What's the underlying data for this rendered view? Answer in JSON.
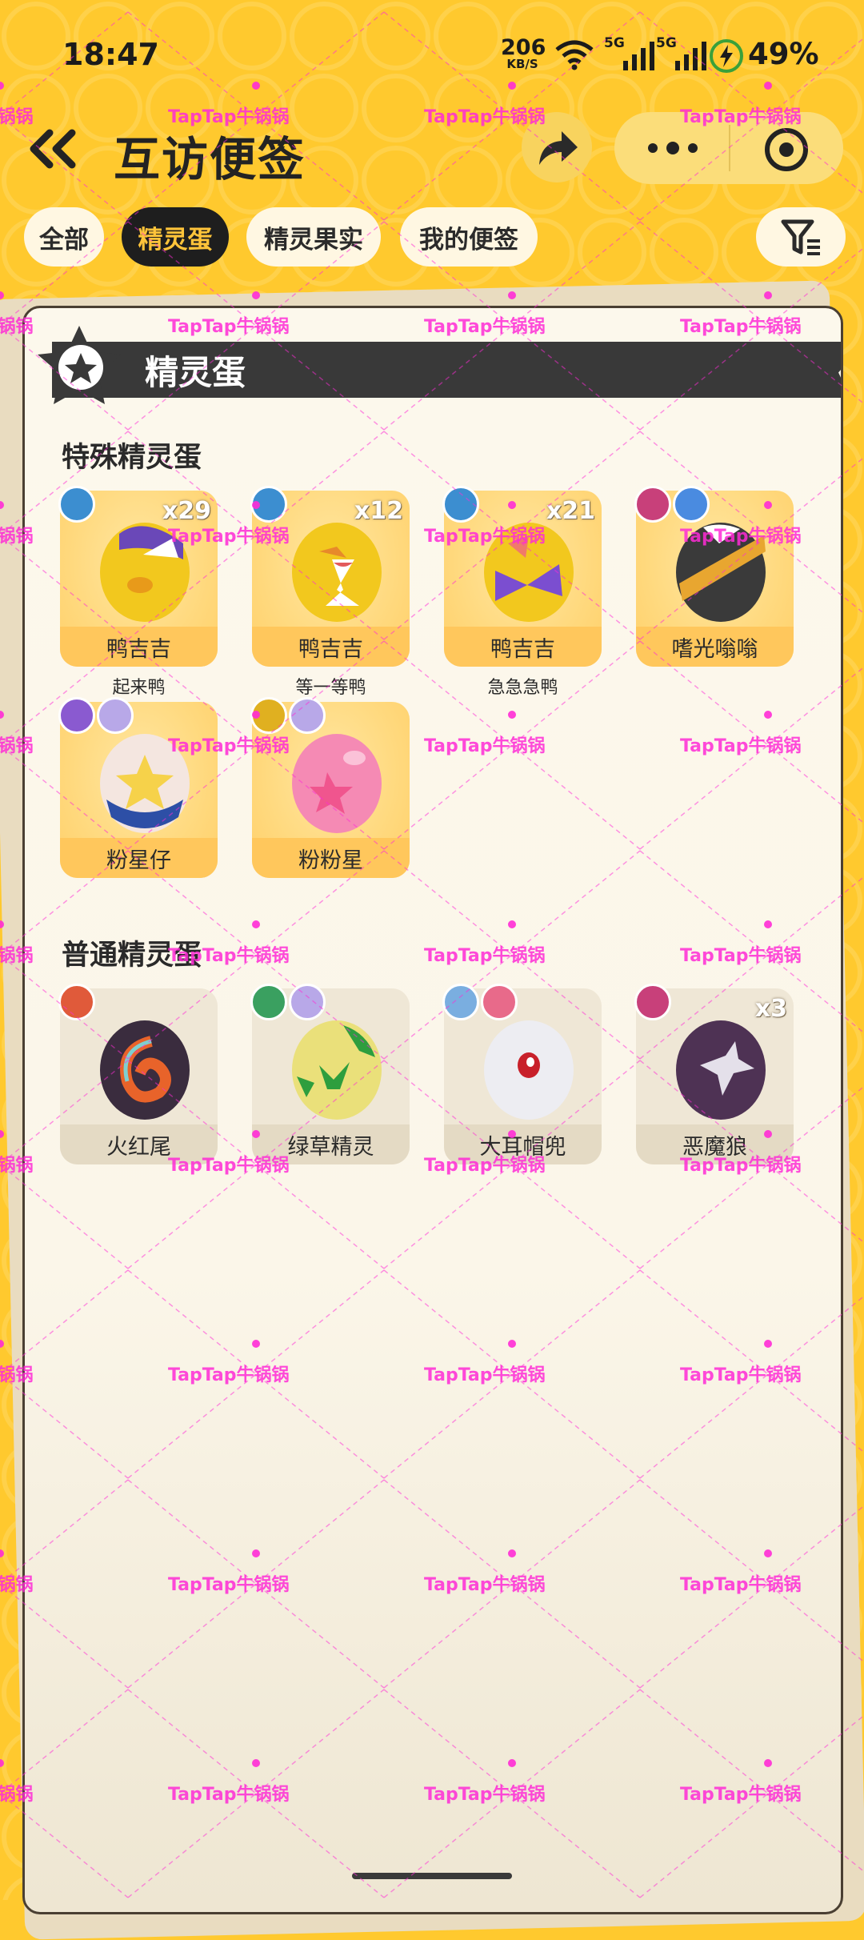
{
  "status_bar": {
    "time": "18:47",
    "net_speed": "206",
    "net_unit": "KB/S",
    "signal_1": "5G",
    "signal_2": "5G",
    "battery": "49%"
  },
  "header": {
    "title": "互访便签"
  },
  "tabs": [
    {
      "label": "全部",
      "active": false
    },
    {
      "label": "精灵蛋",
      "active": true
    },
    {
      "label": "精灵果实",
      "active": false
    },
    {
      "label": "我的便签",
      "active": false
    }
  ],
  "card": {
    "banner_title": "精灵蛋"
  },
  "special_section": {
    "title": "特殊精灵蛋",
    "eggs": [
      {
        "name": "鸭吉吉",
        "count": "x29",
        "subtitle": "起来鸭"
      },
      {
        "name": "鸭吉吉",
        "count": "x12",
        "subtitle": "等一等鸭"
      },
      {
        "name": "鸭吉吉",
        "count": "x21",
        "subtitle": "急急急鸭"
      },
      {
        "name": "嗜光嗡嗡",
        "count": "",
        "subtitle": ""
      },
      {
        "name": "粉星仔",
        "count": "",
        "subtitle": ""
      },
      {
        "name": "粉粉星",
        "count": "",
        "subtitle": ""
      }
    ]
  },
  "normal_section": {
    "title": "普通精灵蛋",
    "eggs": [
      {
        "name": "火红尾",
        "count": ""
      },
      {
        "name": "绿草精灵",
        "count": ""
      },
      {
        "name": "大耳帽兜",
        "count": ""
      },
      {
        "name": "恶魔狼",
        "count": "x3"
      }
    ]
  },
  "watermark": {
    "text": "TapTap牛锅锅"
  },
  "colors": {
    "background": "#FFC92E",
    "active_tab_bg": "#1e1e1e",
    "active_tab_text": "#FFC43A",
    "card": "#FCF8EC",
    "watermark": "#FF2BD6"
  }
}
